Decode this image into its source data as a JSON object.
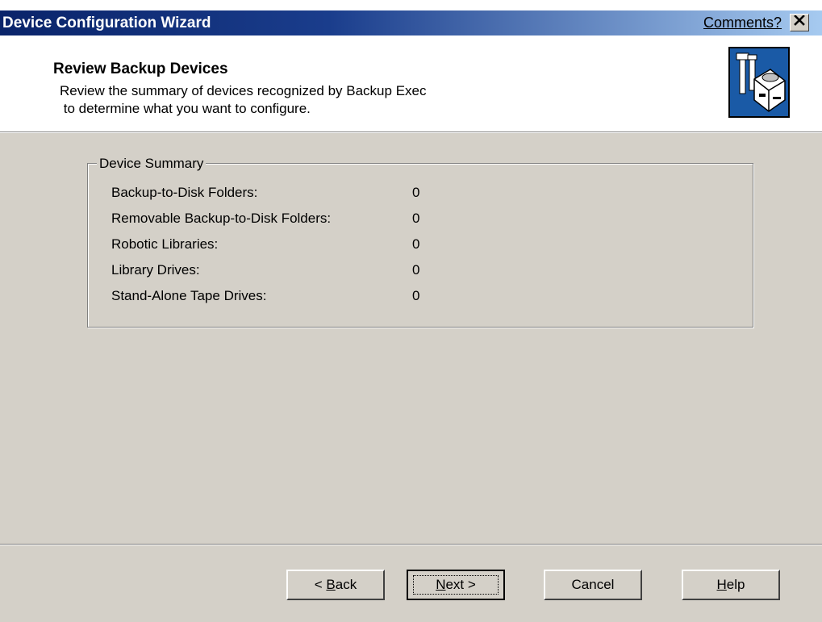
{
  "window": {
    "title": "Device Configuration Wizard",
    "comments_link": "Comments?",
    "close_glyph": "✕"
  },
  "header": {
    "title": "Review Backup Devices",
    "description_line1": "Review the summary of devices recognized by Backup Exec",
    "description_line2": " to determine what you want to configure.",
    "icon": "backup-device-configuration-icon"
  },
  "summary": {
    "legend": "Device Summary",
    "rows": [
      {
        "label": "Backup-to-Disk Folders:",
        "value": "0"
      },
      {
        "label": "Removable Backup-to-Disk Folders:",
        "value": "0"
      },
      {
        "label": "Robotic Libraries:",
        "value": "0"
      },
      {
        "label": "Library Drives:",
        "value": "0"
      },
      {
        "label": "Stand-Alone Tape Drives:",
        "value": "0"
      }
    ]
  },
  "buttons": {
    "back": {
      "prefix": "< ",
      "mnemonic": "B",
      "rest": "ack"
    },
    "next": {
      "mnemonic": "N",
      "rest": "ext >"
    },
    "cancel": {
      "label": "Cancel"
    },
    "help": {
      "mnemonic": "H",
      "rest": "elp"
    }
  },
  "colors": {
    "dialog_background": "#d4d0c8",
    "title_bar_start": "#0a246a",
    "title_bar_end": "#a6caf0",
    "header_background": "#ffffff",
    "icon_background": "#1a5aa6"
  }
}
